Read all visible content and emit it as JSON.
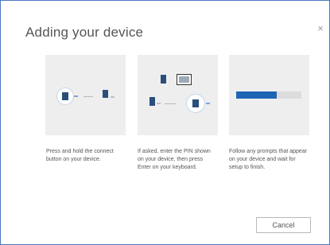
{
  "dialog": {
    "title": "Adding your device",
    "close_glyph": "×",
    "cancel_label": "Cancel"
  },
  "steps": [
    {
      "caption": "Press and hold the connect button on your device."
    },
    {
      "caption": "If asked, enter the PIN shown on your device, then press Enter on your keyboard."
    },
    {
      "caption": "Follow any prompts that appear on your device and wait for setup to finish."
    }
  ],
  "progress": {
    "fraction": 0.62,
    "color": "#1f63b4"
  },
  "colors": {
    "border": "#4a78c2",
    "panel": "#eeeeee",
    "accent": "#1f63b4"
  },
  "icons": [
    "close-icon",
    "pc-icon",
    "bluetooth-device-icon",
    "monitor-icon",
    "progress-bar"
  ]
}
